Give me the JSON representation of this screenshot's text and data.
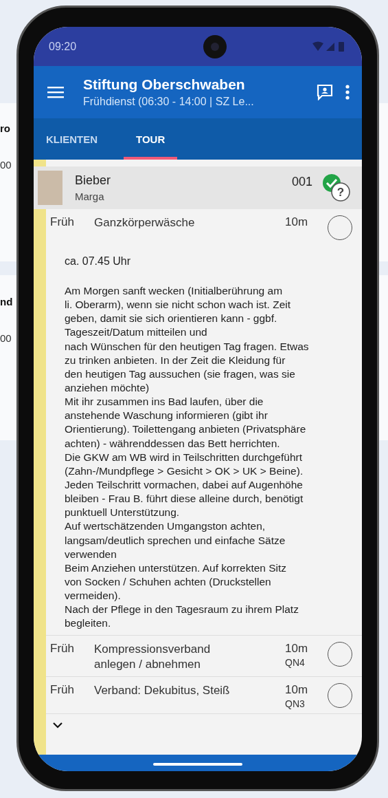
{
  "background_fragments": [
    {
      "text": "ro"
    },
    {
      "text": "00"
    },
    {
      "text": "nd"
    },
    {
      "text": "00"
    }
  ],
  "status_bar": {
    "time": "09:20"
  },
  "app_bar": {
    "title": "Stiftung Oberschwaben",
    "subtitle": "Frühdienst (06:30 - 14:00 | SZ Le..."
  },
  "tabs": [
    {
      "label": "KLIENTEN",
      "selected": false
    },
    {
      "label": "TOUR",
      "selected": true
    }
  ],
  "client": {
    "last_name": "Bieber",
    "first_name": "Marga",
    "number": "001",
    "done": true,
    "pending_symbol": "?"
  },
  "tasks": [
    {
      "shift": "Früh",
      "name": "Ganzkörperwäsche",
      "duration": "10m",
      "done": false,
      "expanded": true,
      "time_note": "ca. 07.45 Uhr",
      "description": "Am Morgen sanft wecken (Initialberührung am\nli. Oberarm), wenn sie nicht schon wach ist. Zeit\ngeben, damit sie sich orientieren kann - ggbf.\nTageszeit/Datum mitteilen und\nnach Wünschen für den heutigen Tag fragen. Etwas\nzu trinken anbieten. In der Zeit die Kleidung für\nden heutigen Tag aussuchen (sie fragen, was sie\nanziehen möchte)\nMit ihr zusammen ins Bad laufen, über die\nanstehende Waschung informieren (gibt ihr\nOrientierung). Toilettengang anbieten (Privatsphäre\nachten) - währenddessen das Bett herrichten.\nDie GKW am WB wird in Teilschritten durchgeführt\n(Zahn-/Mundpflege > Gesicht > OK > UK > Beine).\nJeden Teilschritt vormachen, dabei auf Augenhöhe\nbleiben - Frau B. führt diese alleine durch, benötigt\npunktuell Unterstützung.\nAuf wertschätzenden Umgangston achten,\nlangsam/deutlich sprechen und einfache Sätze\nverwenden\nBeim Anziehen unterstützen. Auf korrekten Sitz\nvon Socken / Schuhen achten (Druckstellen\nvermeiden).\nNach der Pflege in den Tagesraum zu ihrem Platz\nbegleiten."
    },
    {
      "shift": "Früh",
      "name": "Kompressionsverband\nanlegen / abnehmen",
      "duration": "10m",
      "qn": "QN4",
      "done": false,
      "expanded": false
    },
    {
      "shift": "Früh",
      "name": "Verband: Dekubitus, Steiß",
      "duration": "10m",
      "qn": "QN3",
      "done": false,
      "expanded": false
    }
  ]
}
